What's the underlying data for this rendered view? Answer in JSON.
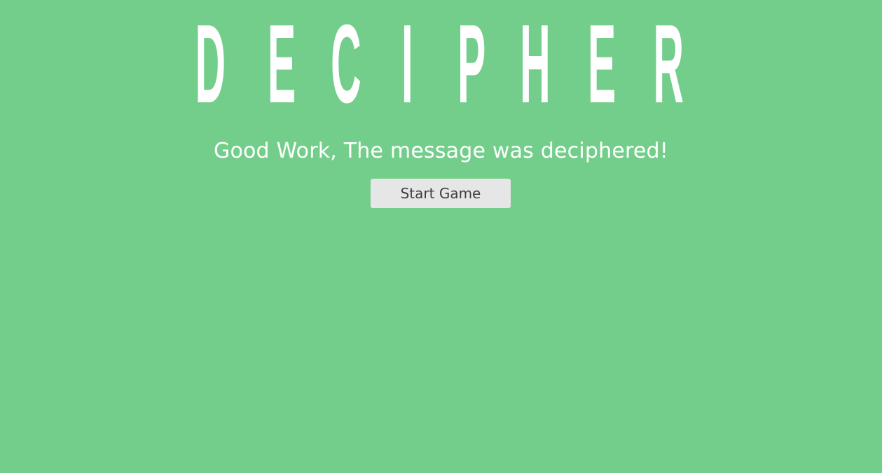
{
  "header": {
    "title": "DECIPHER",
    "letters": [
      "D",
      "E",
      "C",
      "I",
      "P",
      "H",
      "E",
      "R"
    ]
  },
  "main": {
    "message": "Good Work, The message was deciphered!",
    "start_button_label": "Start Game"
  },
  "colors": {
    "background": "#74CE8B",
    "title_text": "#FFFFFF",
    "message_text": "#FFFFFF",
    "button_background": "#E6E6E6",
    "button_text": "#3C3F41"
  }
}
